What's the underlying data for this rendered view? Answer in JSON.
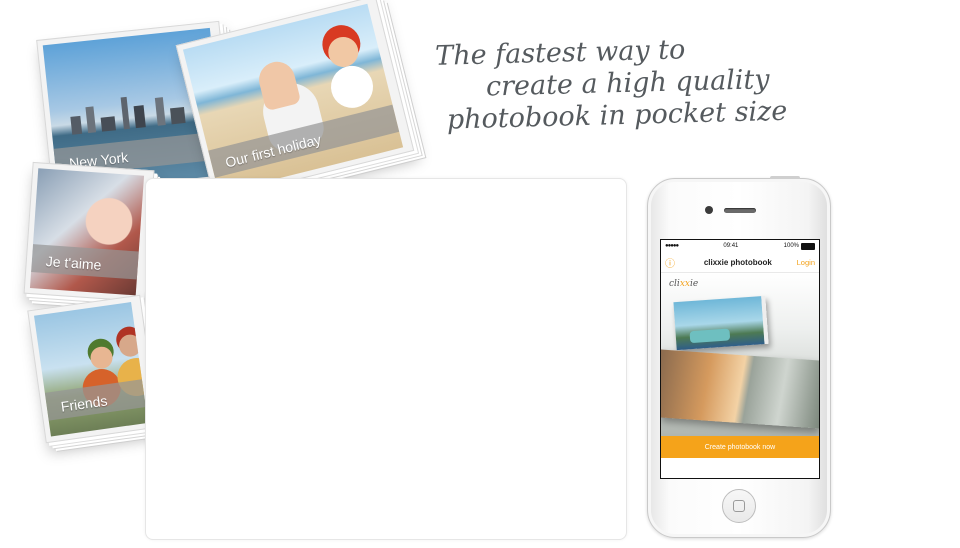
{
  "tagline": {
    "line1": "The fastest way to",
    "line2": "create a high quality",
    "line3": "photobook in pocket size"
  },
  "books": [
    {
      "title": "New York"
    },
    {
      "title": "Our first holiday"
    },
    {
      "title": "Je t'aime"
    },
    {
      "title": "Friends"
    }
  ],
  "phone": {
    "status": {
      "signal": "●●●●● ",
      "time": "09:41",
      "battery": "100%"
    },
    "nav": {
      "info_icon": "ⓘ",
      "title": "clixxie photobook",
      "login": "Login"
    },
    "logo": {
      "pre": "cli",
      "mid": "xx",
      "post": "ie"
    },
    "cta": "Create photobook now"
  },
  "colors": {
    "accent": "#f5a31a",
    "text": "#555a5e"
  }
}
